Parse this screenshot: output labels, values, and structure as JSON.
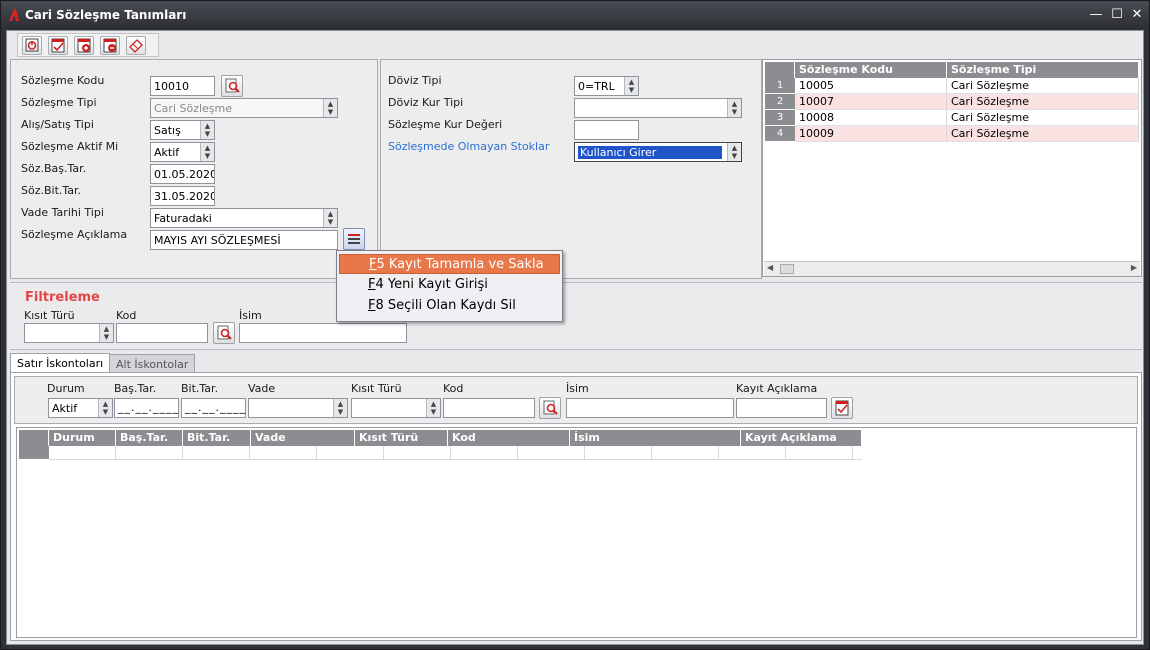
{
  "window": {
    "title": "Cari Sözleşme Tanımları",
    "min": "—",
    "max": "☐",
    "close": "✕"
  },
  "toolbar": {
    "icons": [
      "power-icon",
      "check-list-icon",
      "add-record-icon",
      "delete-record-icon",
      "eraser-icon"
    ]
  },
  "form_left": {
    "labels": {
      "kod": "Sözleşme Kodu",
      "tipi": "Sözleşme Tipi",
      "alis": "Alış/Satış Tipi",
      "aktif": "Sözleşme Aktif Mi",
      "bas": "Söz.Baş.Tar.",
      "bit": "Söz.Bit.Tar.",
      "vade": "Vade Tarihi Tipi",
      "aciklama": "Sözleşme Açıklama"
    },
    "values": {
      "kod": "10010",
      "tipi": "Cari Sözleşme",
      "alis": "Satış",
      "aktif": "Aktif",
      "bas": "01.05.2020",
      "bit": "31.05.2020",
      "vade": "Faturadaki",
      "aciklama": "MAYIS AYI SÖZLEŞMESİ"
    }
  },
  "form_mid": {
    "labels": {
      "doviz": "Döviz Tipi",
      "kur_tipi": "Döviz Kur Tipi",
      "kur_deger": "Sözleşme Kur Değeri",
      "stok": "Sözleşmede Olmayan Stoklar"
    },
    "values": {
      "doviz": "0=TRL",
      "kur_tipi": "",
      "kur_deger": "",
      "stok": "Kullanıcı Girer"
    }
  },
  "contracts_grid": {
    "headers": [
      "Sözleşme Kodu",
      "Sözleşme Tipi"
    ],
    "rows": [
      {
        "n": "1",
        "kod": "10005",
        "tip": "Cari Sözleşme"
      },
      {
        "n": "2",
        "kod": "10007",
        "tip": "Cari Sözleşme"
      },
      {
        "n": "3",
        "kod": "10008",
        "tip": "Cari Sözleşme"
      },
      {
        "n": "4",
        "kod": "10009",
        "tip": "Cari Sözleşme"
      }
    ]
  },
  "context_menu": {
    "items": [
      {
        "key": "F",
        "rest": "5 Kayıt Tamamla ve Sakla"
      },
      {
        "key": "F",
        "rest": "4 Yeni Kayıt Girişi"
      },
      {
        "key": "F",
        "rest": "8 Seçili Olan Kaydı Sil"
      }
    ]
  },
  "filter": {
    "title": "Filtreleme",
    "kisit": "Kısıt Türü",
    "kod": "Kod",
    "isim": "İsim"
  },
  "tabs": [
    "Satır İskontoları",
    "Alt İskontolar"
  ],
  "discount_form": {
    "labels": [
      "Durum",
      "Baş.Tar.",
      "Bit.Tar.",
      "Vade",
      "Kısıt Türü",
      "Kod",
      "İsim",
      "Kayıt Açıklama"
    ],
    "durum": "Aktif",
    "date_mask": "__.__.____"
  },
  "discount_grid": {
    "headers": [
      "Durum",
      "Baş.Tar.",
      "Bit.Tar.",
      "Vade",
      "Kısıt Türü",
      "Kod",
      "İsim",
      "Kayıt Açıklama"
    ]
  },
  "colors": {
    "accent_red": "#e44545",
    "menu_sel": "#e8784a",
    "link_blue": "#2a6fd6",
    "row_pink": "#fbe2e2"
  }
}
